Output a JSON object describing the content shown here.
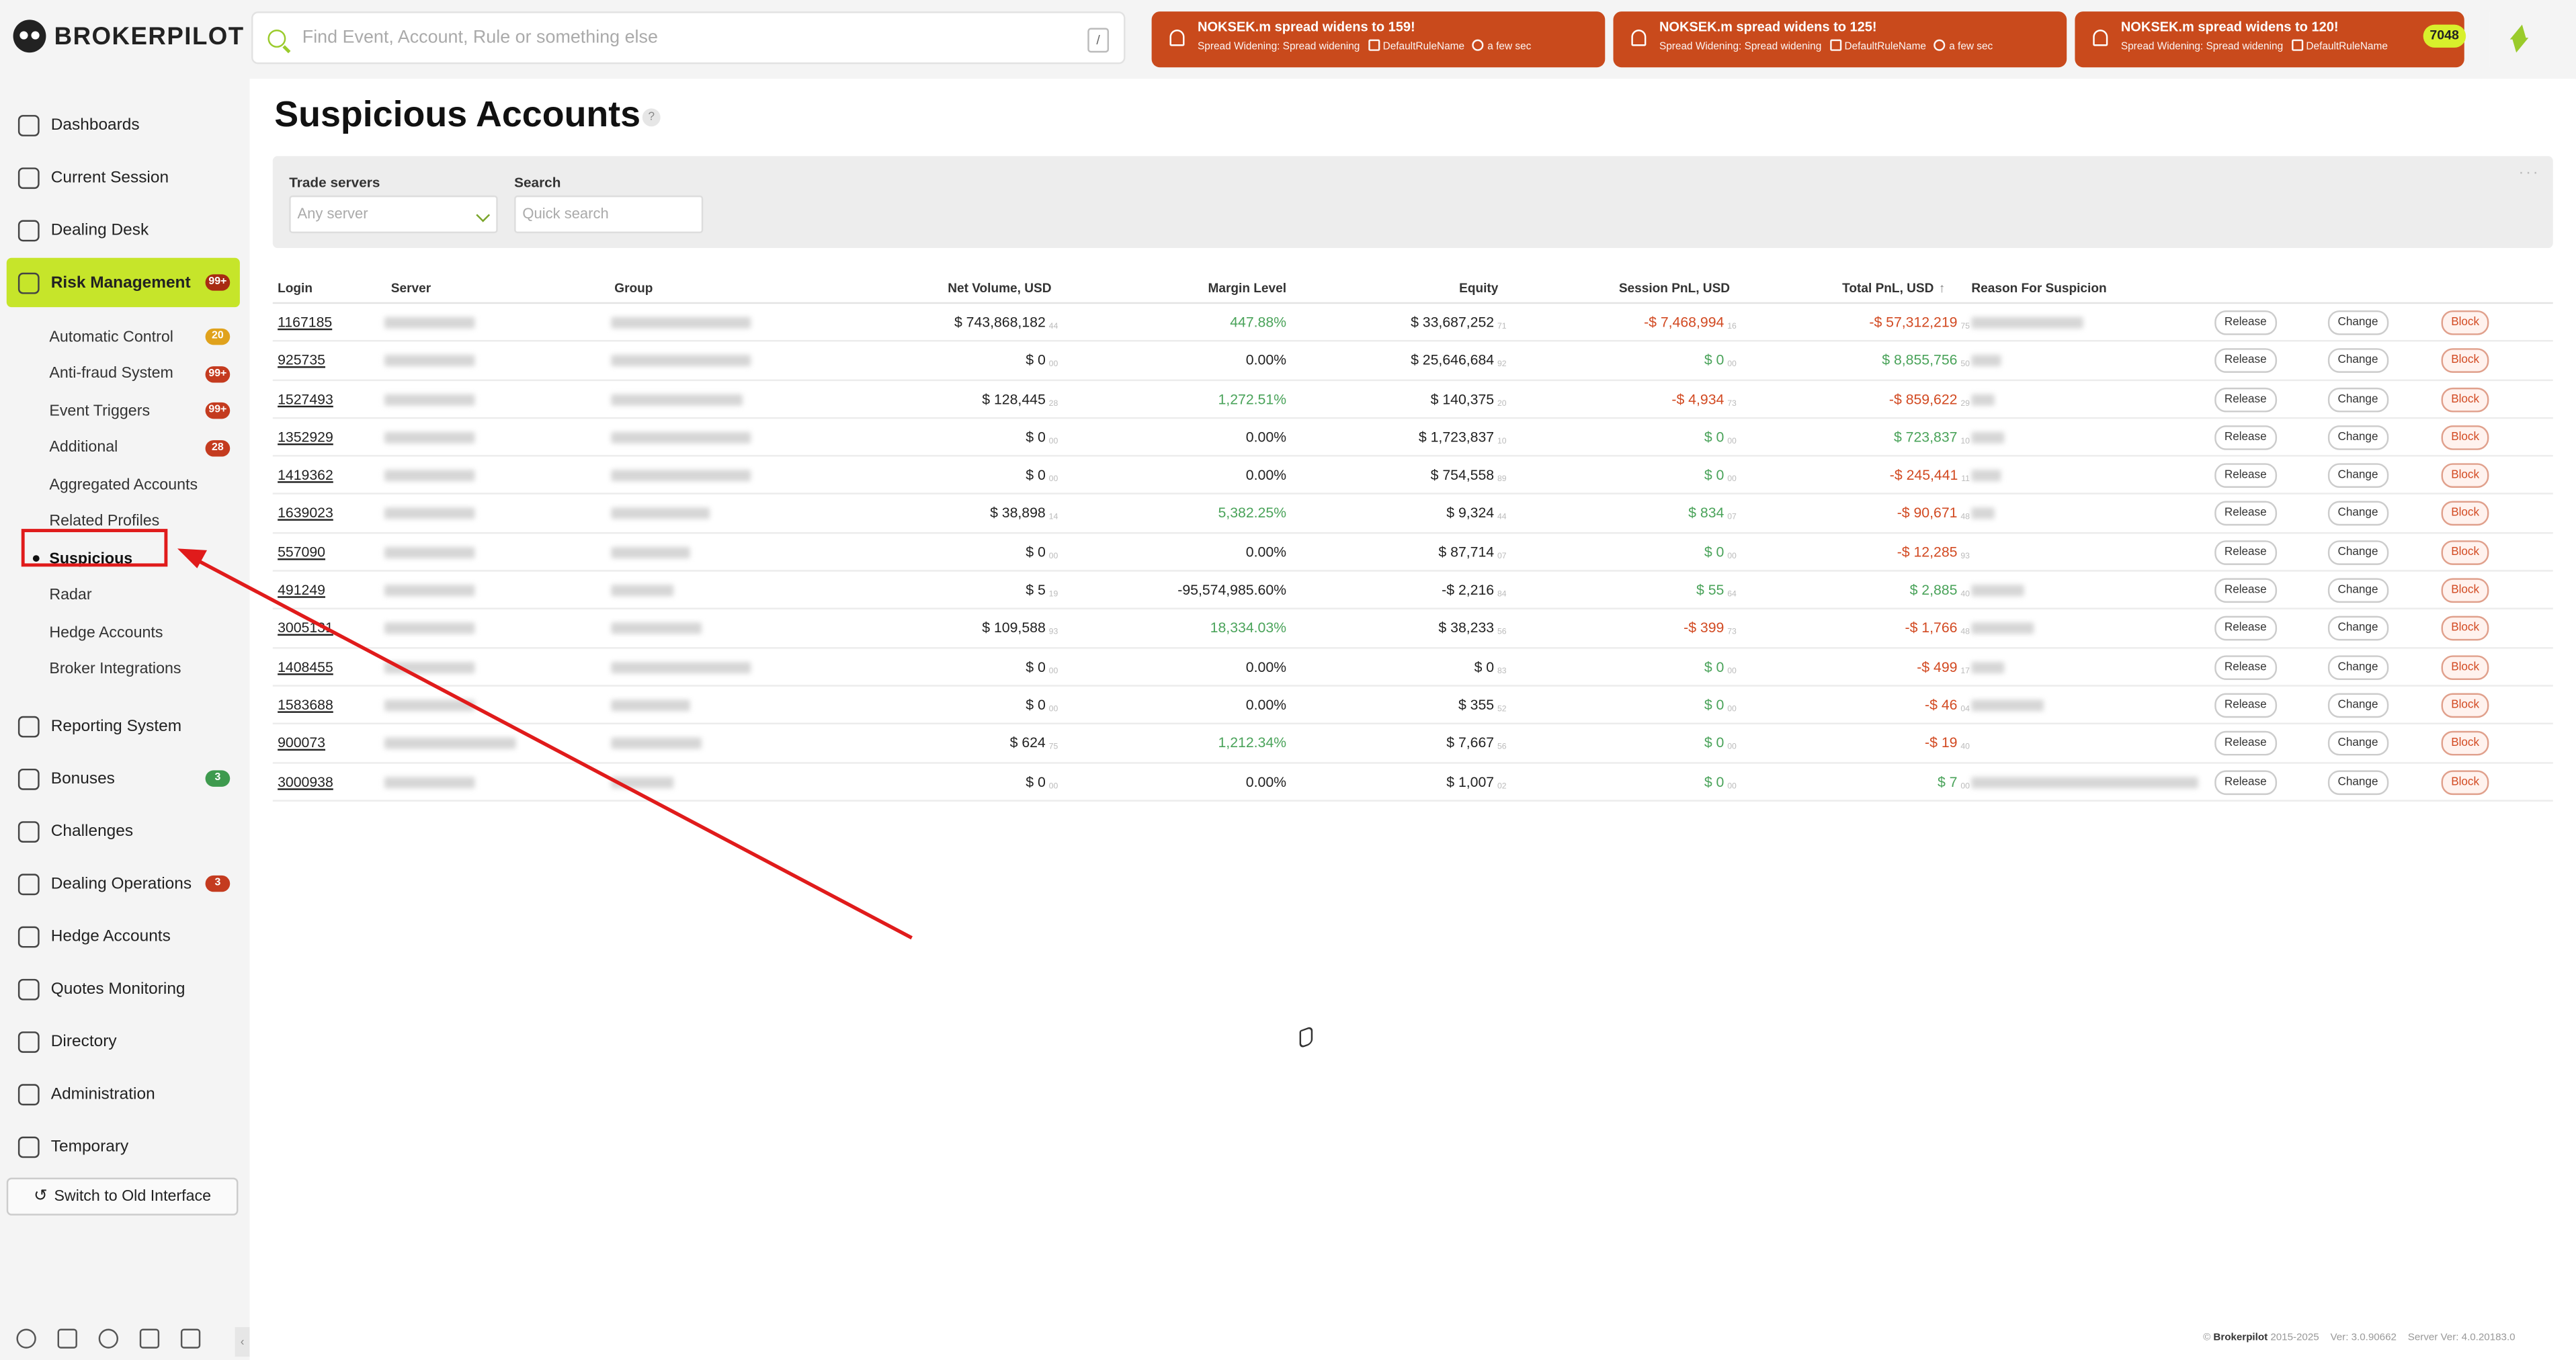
{
  "brand": {
    "name": "BROKERPILOT"
  },
  "search": {
    "placeholder": "Find Event, Account, Rule or something else",
    "shortcut": "/"
  },
  "notifications": [
    {
      "title": "NOKSEK.m spread widens to 159!",
      "category": "Spread Widening: Spread widening",
      "rule": "DefaultRuleName",
      "time": "a few sec"
    },
    {
      "title": "NOKSEK.m spread widens to 125!",
      "category": "Spread Widening: Spread widening",
      "rule": "DefaultRuleName",
      "time": "a few sec"
    },
    {
      "title": "NOKSEK.m spread widens to 120!",
      "category": "Spread Widening: Spread widening",
      "rule": "DefaultRuleName",
      "time": ""
    }
  ],
  "notification_count": "7048",
  "sidebar": {
    "items": [
      {
        "label": "Dashboards"
      },
      {
        "label": "Current Session"
      },
      {
        "label": "Dealing Desk"
      },
      {
        "label": "Risk Management",
        "badge": "99+"
      }
    ],
    "sub_items": [
      {
        "label": "Automatic Control",
        "badge": "20"
      },
      {
        "label": "Anti-fraud System",
        "badge": "99+"
      },
      {
        "label": "Event Triggers",
        "badge": "99+"
      },
      {
        "label": "Additional",
        "badge": "28"
      },
      {
        "label": "Aggregated Accounts"
      },
      {
        "label": "Related Profiles"
      },
      {
        "label": "Suspicious"
      },
      {
        "label": "Radar"
      },
      {
        "label": "Hedge Accounts"
      },
      {
        "label": "Broker Integrations"
      }
    ],
    "lower_items": [
      {
        "label": "Reporting System"
      },
      {
        "label": "Bonuses",
        "badge": "3"
      },
      {
        "label": "Challenges"
      },
      {
        "label": "Dealing Operations",
        "badge": "3"
      },
      {
        "label": "Hedge Accounts"
      },
      {
        "label": "Quotes Monitoring"
      },
      {
        "label": "Directory"
      },
      {
        "label": "Administration"
      },
      {
        "label": "Temporary"
      }
    ],
    "switch_label": "Switch to Old Interface"
  },
  "page": {
    "title": "Suspicious Accounts",
    "help": "?",
    "filters": {
      "trade_servers_label": "Trade servers",
      "trade_servers_placeholder": "Any server",
      "search_label": "Search",
      "search_placeholder": "Quick search"
    }
  },
  "table": {
    "columns": [
      "Login",
      "Server",
      "Group",
      "Net Volume, USD",
      "Margin Level",
      "Equity",
      "Session PnL, USD",
      "Total PnL, USD",
      "Reason For Suspicion"
    ],
    "sort_indicator": "↑",
    "actions": {
      "release": "Release",
      "change": "Change",
      "block": "Block"
    },
    "rows": [
      {
        "login": "1167185",
        "net_volume": "$ 743,868,182",
        "nv_c": "44",
        "margin": "447.88%",
        "margin_c": "pos",
        "equity": "$ 33,687,252",
        "eq_c": "71",
        "session": "-$ 7,468,994",
        "s_c": "16",
        "s_cls": "neg",
        "total": "-$ 57,312,219",
        "t_c": "75",
        "t_cls": "neg"
      },
      {
        "login": "925735",
        "net_volume": "$ 0",
        "nv_c": "00",
        "margin": "0.00%",
        "margin_c": "",
        "equity": "$ 25,646,684",
        "eq_c": "92",
        "session": "$ 0",
        "s_c": "00",
        "s_cls": "pos",
        "total": "$ 8,855,756",
        "t_c": "50",
        "t_cls": "pos"
      },
      {
        "login": "1527493",
        "net_volume": "$ 128,445",
        "nv_c": "28",
        "margin": "1,272.51%",
        "margin_c": "pos",
        "equity": "$ 140,375",
        "eq_c": "20",
        "session": "-$ 4,934",
        "s_c": "73",
        "s_cls": "neg",
        "total": "-$ 859,622",
        "t_c": "29",
        "t_cls": "neg"
      },
      {
        "login": "1352929",
        "net_volume": "$ 0",
        "nv_c": "00",
        "margin": "0.00%",
        "margin_c": "",
        "equity": "$ 1,723,837",
        "eq_c": "10",
        "session": "$ 0",
        "s_c": "00",
        "s_cls": "pos",
        "total": "$ 723,837",
        "t_c": "10",
        "t_cls": "pos"
      },
      {
        "login": "1419362",
        "net_volume": "$ 0",
        "nv_c": "00",
        "margin": "0.00%",
        "margin_c": "",
        "equity": "$ 754,558",
        "eq_c": "89",
        "session": "$ 0",
        "s_c": "00",
        "s_cls": "pos",
        "total": "-$ 245,441",
        "t_c": "11",
        "t_cls": "neg"
      },
      {
        "login": "1639023",
        "net_volume": "$ 38,898",
        "nv_c": "14",
        "margin": "5,382.25%",
        "margin_c": "pos",
        "equity": "$ 9,324",
        "eq_c": "44",
        "session": "$ 834",
        "s_c": "07",
        "s_cls": "pos",
        "total": "-$ 90,671",
        "t_c": "48",
        "t_cls": "neg"
      },
      {
        "login": "557090",
        "net_volume": "$ 0",
        "nv_c": "00",
        "margin": "0.00%",
        "margin_c": "",
        "equity": "$ 87,714",
        "eq_c": "07",
        "session": "$ 0",
        "s_c": "00",
        "s_cls": "pos",
        "total": "-$ 12,285",
        "t_c": "93",
        "t_cls": "neg"
      },
      {
        "login": "491249",
        "net_volume": "$ 5",
        "nv_c": "19",
        "margin": "-95,574,985.60%",
        "margin_c": "",
        "equity": "-$ 2,216",
        "eq_c": "84",
        "session": "$ 55",
        "s_c": "64",
        "s_cls": "pos",
        "total": "$ 2,885",
        "t_c": "40",
        "t_cls": "pos"
      },
      {
        "login": "3005131",
        "net_volume": "$ 109,588",
        "nv_c": "93",
        "margin": "18,334.03%",
        "margin_c": "pos",
        "equity": "$ 38,233",
        "eq_c": "56",
        "session": "-$ 399",
        "s_c": "73",
        "s_cls": "neg",
        "total": "-$ 1,766",
        "t_c": "48",
        "t_cls": "neg"
      },
      {
        "login": "1408455",
        "net_volume": "$ 0",
        "nv_c": "00",
        "margin": "0.00%",
        "margin_c": "",
        "equity": "$ 0",
        "eq_c": "83",
        "session": "$ 0",
        "s_c": "00",
        "s_cls": "pos",
        "total": "-$ 499",
        "t_c": "17",
        "t_cls": "neg"
      },
      {
        "login": "1583688",
        "net_volume": "$ 0",
        "nv_c": "00",
        "margin": "0.00%",
        "margin_c": "",
        "equity": "$ 355",
        "eq_c": "52",
        "session": "$ 0",
        "s_c": "00",
        "s_cls": "pos",
        "total": "-$ 46",
        "t_c": "04",
        "t_cls": "neg"
      },
      {
        "login": "900073",
        "net_volume": "$ 624",
        "nv_c": "75",
        "margin": "1,212.34%",
        "margin_c": "pos",
        "equity": "$ 7,667",
        "eq_c": "56",
        "session": "$ 0",
        "s_c": "00",
        "s_cls": "pos",
        "total": "-$ 19",
        "t_c": "40",
        "t_cls": "neg"
      },
      {
        "login": "3000938",
        "net_volume": "$ 0",
        "nv_c": "00",
        "margin": "0.00%",
        "margin_c": "",
        "equity": "$ 1,007",
        "eq_c": "02",
        "session": "$ 0",
        "s_c": "00",
        "s_cls": "pos",
        "total": "$ 7",
        "t_c": "00",
        "t_cls": "pos"
      }
    ]
  },
  "footer": {
    "copyright": "© ",
    "brand": "Brokerpilot",
    "years": " 2015-2025",
    "version": "Ver: 3.0.90662",
    "server_version": "Server Ver: 4.0.20183.0"
  },
  "colors": {
    "accent": "#c6e52a",
    "alert": "#c94a1c",
    "positive": "#4aa35a",
    "negative": "#d24a22",
    "annotation": "#e01b1b"
  }
}
